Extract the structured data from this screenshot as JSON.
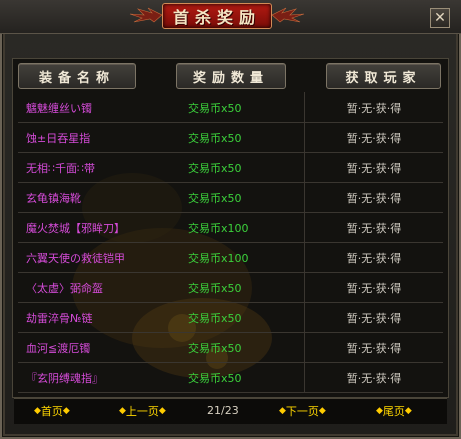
{
  "window": {
    "title": "首杀奖励",
    "close_label": "✕"
  },
  "headers": [
    "装备名称",
    "奖励数量",
    "获取玩家"
  ],
  "rows": [
    {
      "item": "魑魅缠丝い镯",
      "reward": "交易币x50",
      "winner": "暂·无·获·得"
    },
    {
      "item": "蚀±日吞星指",
      "reward": "交易币x50",
      "winner": "暂·无·获·得"
    },
    {
      "item": "无相∷千面∷带",
      "reward": "交易币x50",
      "winner": "暂·无·获·得"
    },
    {
      "item": "玄龟镇海靴",
      "reward": "交易币x50",
      "winner": "暂·无·获·得"
    },
    {
      "item": "魔火焚城【邪眸刀】",
      "reward": "交易币x100",
      "winner": "暂·无·获·得"
    },
    {
      "item": "六翼天使の救徒铠甲",
      "reward": "交易币x100",
      "winner": "暂·无·获·得"
    },
    {
      "item": "〈太虚〉弼命盔",
      "reward": "交易币x50",
      "winner": "暂·无·获·得"
    },
    {
      "item": "劫雷淬骨№链",
      "reward": "交易币x50",
      "winner": "暂·无·获·得"
    },
    {
      "item": "血河≦渡厄镯",
      "reward": "交易币x50",
      "winner": "暂·无·获·得"
    },
    {
      "item": "『玄阴缚魂指』",
      "reward": "交易币x50",
      "winner": "暂·无·获·得"
    }
  ],
  "footer": {
    "first": "首页",
    "prev": "上一页",
    "page_indicator": "21/23",
    "next": "下一页",
    "last": "尾页",
    "diamond": "◆"
  },
  "colors": {
    "item": "#d54bd8",
    "reward": "#3bd13b",
    "winner": "#cfcac0",
    "nav": "#ffd700",
    "banner": "#b21a12"
  }
}
